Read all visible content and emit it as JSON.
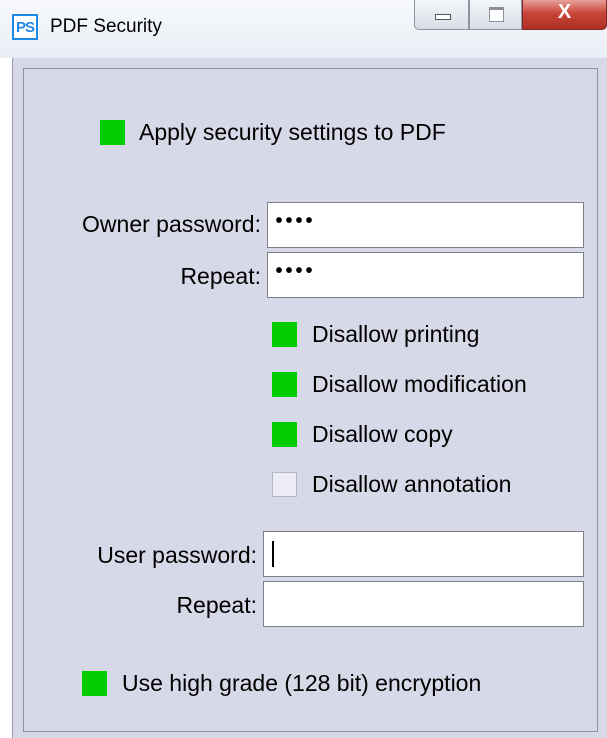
{
  "window": {
    "title": "PDF Security",
    "app_icon_text": "PS",
    "close_glyph": "X"
  },
  "apply": {
    "label": "Apply security settings to PDF",
    "checked": true
  },
  "owner": {
    "password_label": "Owner password:",
    "password_value": "••••",
    "repeat_label": "Repeat:",
    "repeat_value": "••••"
  },
  "permissions": [
    {
      "label": "Disallow printing",
      "checked": true
    },
    {
      "label": "Disallow modification",
      "checked": true
    },
    {
      "label": "Disallow copy",
      "checked": true
    },
    {
      "label": "Disallow annotation",
      "checked": false
    }
  ],
  "user": {
    "password_label": "User password:",
    "password_value": "",
    "repeat_label": "Repeat:",
    "repeat_value": ""
  },
  "encryption": {
    "label": "Use high grade (128 bit) encryption",
    "checked": true
  },
  "colors": {
    "checked": "#00cc00",
    "dialog_bg": "#d8d9e8"
  }
}
